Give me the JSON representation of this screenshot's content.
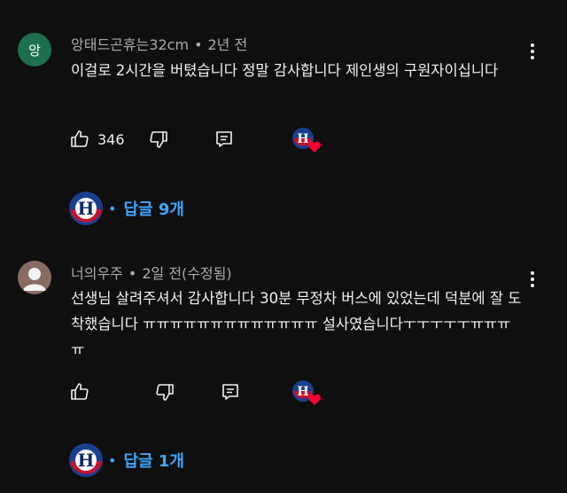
{
  "comments": [
    {
      "avatar_text": "앙",
      "author": "앙태드곤휴는32cm",
      "time": "2년 전",
      "text": "이걸로 2시간을 버텼습니다 정말 감사합니다 제인생의 구원자이십니다",
      "likes": "346",
      "replies_label": "답글 9개"
    },
    {
      "avatar_text": "",
      "author": "너의우주",
      "time": "2일 전(수정됨)",
      "text": "선생님 살려주셔서 감사합니다 30분 무정차 버스에 있었는데 덕분에 잘 도착했습니다 ㅠㅠㅠㅠㅠㅠㅠㅠㅠㅠㅠㅠㅠ 설사였습니다ㅜㅜㅜㅜㅜㅠㅠㅠㅠ",
      "likes": "",
      "replies_label": "답글 1개"
    }
  ],
  "icons": {
    "like": "thumb-up-icon",
    "dislike": "thumb-down-icon",
    "reply": "reply-icon",
    "more": "more-vert-icon",
    "heart": "heart-icon"
  },
  "colors": {
    "background": "#0f0f0f",
    "link": "#3ea6ff",
    "heart": "#ff0033"
  }
}
